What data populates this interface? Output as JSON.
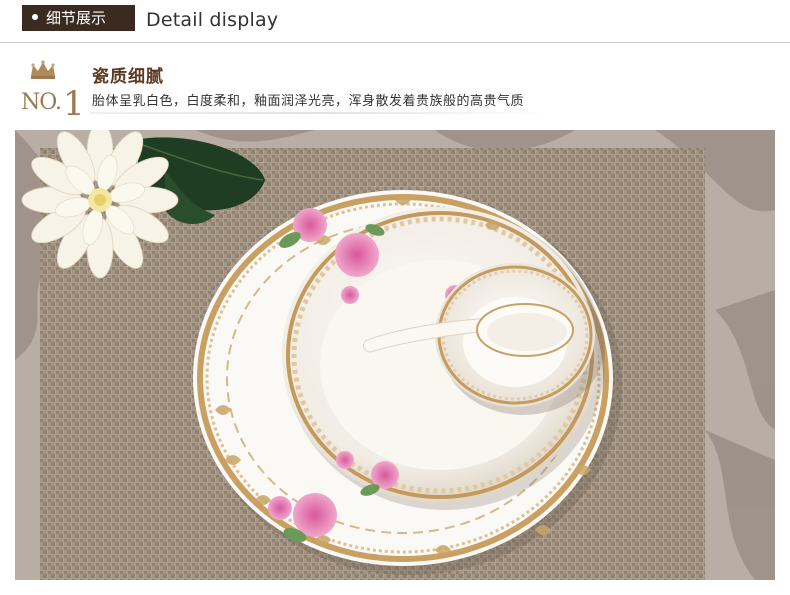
{
  "header": {
    "tab_label": "细节展示",
    "title": "Detail display"
  },
  "section": {
    "number_prefix": "NO.",
    "number": "1",
    "title": "瓷质细腻",
    "description": "胎体呈乳白色，白度柔和，釉面润泽光亮，浑身散发着贵族般的高贵气质"
  },
  "colors": {
    "tab_bg": "#3a2a20",
    "accent_gold": "#9a7a52",
    "title_brown": "#5a3a22"
  },
  "icons": [
    "crown-icon"
  ]
}
